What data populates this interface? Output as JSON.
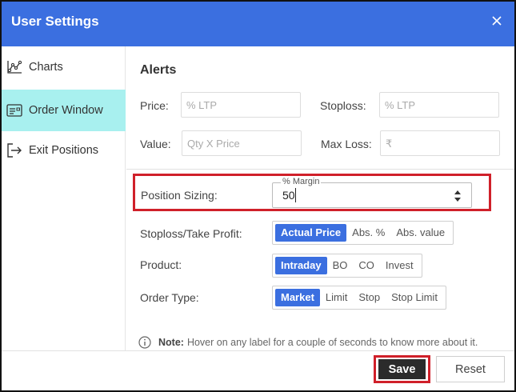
{
  "header": {
    "title": "User Settings",
    "close_icon": "close-icon",
    "color": "#3b6fe0"
  },
  "sidebar": {
    "items": [
      {
        "label": "Charts",
        "icon": "line-chart-icon",
        "active": false
      },
      {
        "label": "Order Window",
        "icon": "order-window-icon",
        "active": true
      },
      {
        "label": "Exit Positions",
        "icon": "exit-icon",
        "active": false
      }
    ],
    "active_color": "#a8f0ef"
  },
  "alerts": {
    "title": "Alerts",
    "price_label": "Price:",
    "price_placeholder": "% LTP",
    "stoploss_label": "Stoploss:",
    "stoploss_placeholder": "% LTP",
    "value_label": "Value:",
    "value_placeholder": "Qty X Price",
    "maxloss_label": "Max Loss:",
    "maxloss_placeholder": "₹"
  },
  "position_sizing": {
    "label": "Position Sizing:",
    "field_legend": "% Margin",
    "value": "50"
  },
  "stoploss_takeprofit": {
    "label": "Stoploss/Take Profit:",
    "options": [
      "Actual Price",
      "Abs. %",
      "Abs. value"
    ],
    "selected": "Actual Price"
  },
  "product": {
    "label": "Product:",
    "options": [
      "Intraday",
      "BO",
      "CO",
      "Invest"
    ],
    "selected": "Intraday"
  },
  "order_type": {
    "label": "Order Type:",
    "options": [
      "Market",
      "Limit",
      "Stop",
      "Stop Limit"
    ],
    "selected": "Market"
  },
  "note": {
    "bold": "Note:",
    "text": "Hover on any label for a couple of seconds to know more about it.",
    "icon": "info-icon"
  },
  "footer": {
    "save_label": "Save",
    "reset_label": "Reset"
  },
  "colors": {
    "accent": "#3b6fe0",
    "highlight": "#d0202a",
    "save_bg": "#2b2b2b"
  }
}
